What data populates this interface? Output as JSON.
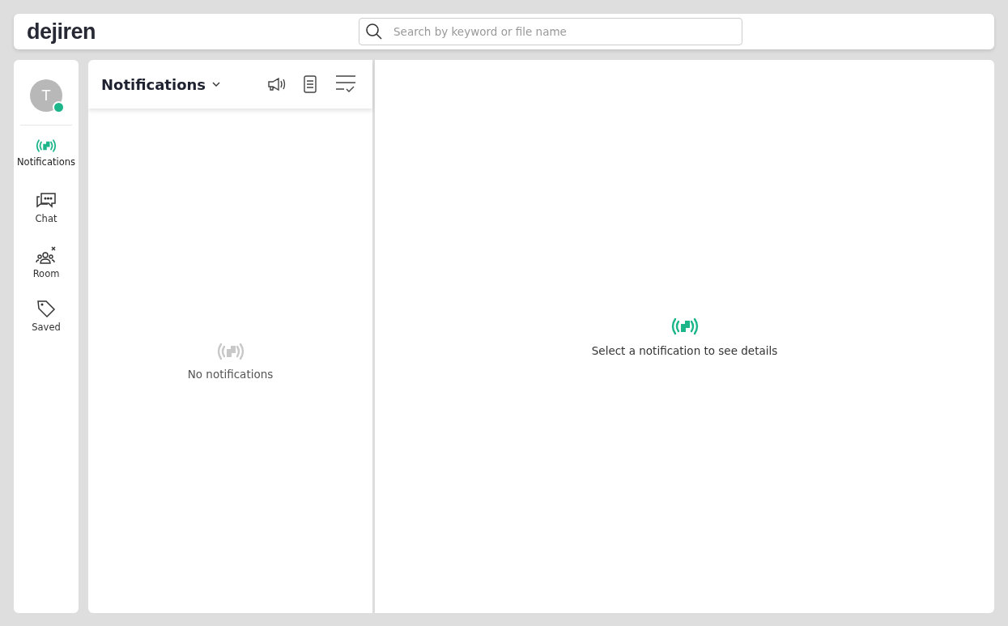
{
  "header": {
    "logo": "dejiren",
    "search": {
      "placeholder": "Search by keyword or file name"
    }
  },
  "sidebar": {
    "avatar": {
      "initial": "T",
      "online": true
    },
    "items": [
      {
        "kind": "notifications",
        "label": "Notifications",
        "selected": true
      },
      {
        "kind": "chat",
        "label": "Chat",
        "selected": false
      },
      {
        "kind": "room",
        "label": "Room",
        "selected": false
      },
      {
        "kind": "saved",
        "label": "Saved",
        "selected": false
      }
    ]
  },
  "list_panel": {
    "title": "Notifications",
    "empty_text": "No notifications"
  },
  "detail_panel": {
    "empty_text": "Select a notification to see details"
  }
}
